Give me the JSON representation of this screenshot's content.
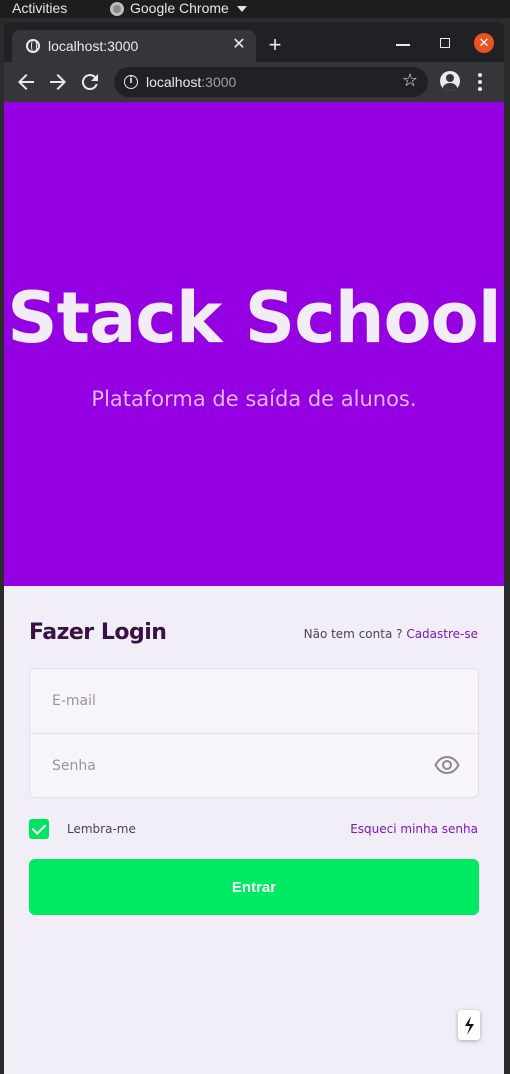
{
  "os": {
    "activities": "Activities",
    "app_name": "Google Chrome"
  },
  "browser": {
    "tab_title": "localhost:3000",
    "url_host": "localhost",
    "url_port": ":3000"
  },
  "hero": {
    "title": "Stack School",
    "subtitle": "Plataforma de saída de alunos."
  },
  "login": {
    "title": "Fazer Login",
    "no_account": "Não tem conta ?",
    "signup_link": "Cadastre-se",
    "email_placeholder": "E-mail",
    "password_placeholder": "Senha",
    "remember_label": "Lembra-me",
    "remember_checked": true,
    "forgot_link": "Esqueci minha senha",
    "submit_label": "Entrar"
  },
  "colors": {
    "hero_bg": "#9400e1",
    "accent_purple": "#7a16c8",
    "button_green": "#00e962",
    "page_bg": "#f1eef7"
  }
}
